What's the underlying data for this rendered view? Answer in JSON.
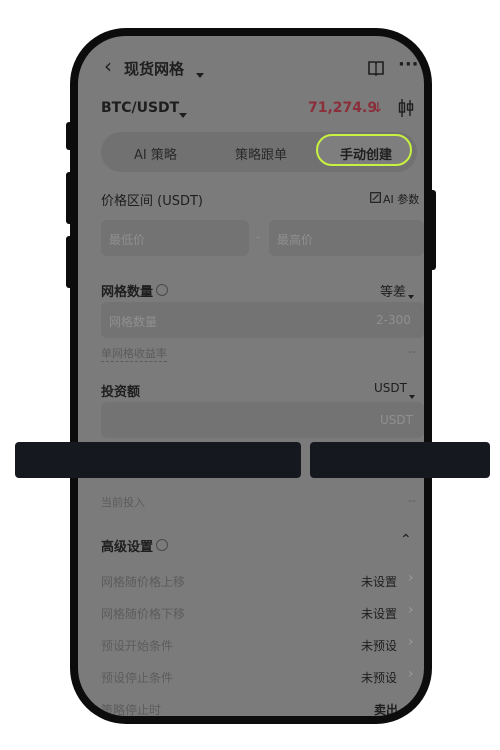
{
  "header": {
    "title": "现货网格",
    "back_icon": "chevron-left-icon",
    "book_icon": "book-icon",
    "more_icon": "more-icon"
  },
  "pair": {
    "name": "BTC/USDT",
    "price": "71,274.9",
    "arrow": "↓",
    "price_color": "#8a2e3a",
    "chart_icon": "candlestick-icon"
  },
  "tabs": [
    {
      "label": "AI 策略",
      "active": false
    },
    {
      "label": "策略跟单",
      "active": false
    },
    {
      "label": "手动创建",
      "active": true
    }
  ],
  "price_range": {
    "label": "价格区间 (USDT)",
    "ai_param": "AI 参数",
    "min_placeholder": "最低价",
    "dash": "-",
    "max_placeholder": "最高价"
  },
  "grid": {
    "label": "网格数量",
    "mode": "等差",
    "placeholder": "网格数量",
    "range": "2-300",
    "profit_label": "单网格收益率",
    "profit_value": "--"
  },
  "invest": {
    "label": "投资额",
    "currency": "USDT",
    "placeholder": "USDT",
    "current_label": "当前投入",
    "current_value": "--"
  },
  "advanced": {
    "label": "高级设置",
    "rows": [
      {
        "label": "网格随价格上移",
        "value": "未设置"
      },
      {
        "label": "网格随价格下移",
        "value": "未设置"
      },
      {
        "label": "预设开始条件",
        "value": "未预设"
      },
      {
        "label": "预设停止条件",
        "value": "未预设"
      },
      {
        "label": "策略停止时",
        "value": "卖出"
      }
    ]
  },
  "colors": {
    "accent": "#c7f23f",
    "overlay_bar": "#16181f"
  }
}
